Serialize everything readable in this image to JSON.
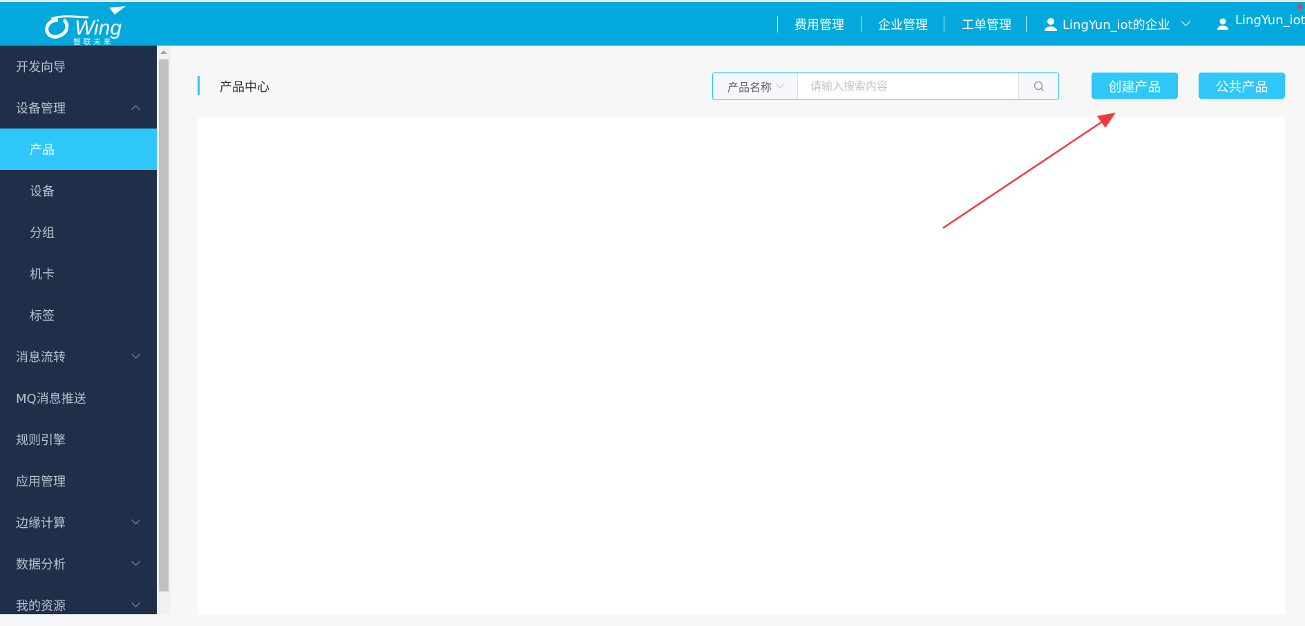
{
  "header": {
    "logo_text": "Wing",
    "logo_sub": "智 联 未 来",
    "nav": [
      "费用管理",
      "企业管理",
      "工单管理"
    ],
    "enterprise": "LingYun_iot的企业",
    "user": "LingYun_iot"
  },
  "sidebar": {
    "items": [
      {
        "label": "开发向导"
      },
      {
        "label": "设备管理"
      },
      {
        "label": "产品"
      },
      {
        "label": "设备"
      },
      {
        "label": "分组"
      },
      {
        "label": "机卡"
      },
      {
        "label": "标签"
      },
      {
        "label": "消息流转"
      },
      {
        "label": "MQ消息推送"
      },
      {
        "label": "规则引擎"
      },
      {
        "label": "应用管理"
      },
      {
        "label": "边缘计算"
      },
      {
        "label": "数据分析"
      },
      {
        "label": "我的资源"
      }
    ]
  },
  "main": {
    "title": "产品中心",
    "search_field": "产品名称",
    "search_placeholder": "请输入搜索内容",
    "create_button": "创建产品",
    "public_button": "公共产品"
  },
  "colors": {
    "header": "#03a9dc",
    "sidebar": "#1f2f4a",
    "accent": "#2ec7f8",
    "arrow": "#f03a3a"
  }
}
